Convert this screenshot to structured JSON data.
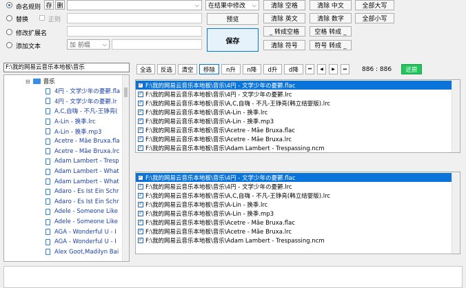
{
  "options": {
    "naming_rule": "命名规则",
    "save_short": "存",
    "delete_short": "删",
    "replace": "替换",
    "regex": "正则",
    "modify_ext": "修改扩展名",
    "add_text": "添加文本",
    "add_position": "加 前缀",
    "replace_scope": "在结果中修改"
  },
  "actions": {
    "preview": "预览",
    "save": "保存",
    "clear_space": "清除 空格",
    "clear_english": "清除 英文",
    "to_space": "_ 转成空格",
    "clear_symbol": "清除 符号",
    "clear_chinese": "清除 中文",
    "clear_digits": "清除 数字",
    "space_to_underscore": "空格 转成 _",
    "symbol_to_underscore": "符号 转成 _",
    "all_upper": "全部大写",
    "all_lower": "全部小写"
  },
  "path": "F:\\我的网易云音乐本地板\\音乐",
  "tree": {
    "folder": "音乐",
    "items": [
      "4円 - 文学少年の憂鬱.fla",
      "4円 - 文学少年の憂鬱.lr",
      "A,C,自嗨 - 不凡-王铮亮(",
      "A-Lin - 换季.lrc",
      "A-Lin - 换季.mp3",
      "Acetre - Mãe Bruxa.fla",
      "Acetre - Mãe Bruxa.lrc",
      "Adam Lambert - Tresp",
      "Adam Lambert - What",
      "Adam Lambert - What",
      "Adaro - Es Ist Ein Schr",
      "Adaro - Es Ist Ein Schr",
      "Adele - Someone Like",
      "Adele - Someone Like",
      "AGA - Wonderful U - I",
      "AGA - Wonderful U - I",
      "Alex Goot,Madilyn Bai"
    ]
  },
  "toolbar": {
    "select_all": "全选",
    "invert": "反选",
    "clear": "清空",
    "remove": "移除",
    "n_up": "n升",
    "n_down": "n降",
    "d_up": "d升",
    "d_down": "d降",
    "count": "886 : 886",
    "restore": "还原"
  },
  "files_top": [
    "F:\\我的网易云音乐本地板\\音乐\\4円 - 文学少年の憂鬱.flac",
    "F:\\我的网易云音乐本地板\\音乐\\4円 - 文学少年の憂鬱.lrc",
    "F:\\我的网易云音乐本地板\\音乐\\A,C,自嗨 - 不凡-王铮亮(韩立结婴版).lrc",
    "F:\\我的网易云音乐本地板\\音乐\\A-Lin - 换季.lrc",
    "F:\\我的网易云音乐本地板\\音乐\\A-Lin - 换季.mp3",
    "F:\\我的网易云音乐本地板\\音乐\\Acetre - Mãe Bruxa.flac",
    "F:\\我的网易云音乐本地板\\音乐\\Acetre - Mãe Bruxa.lrc",
    "F:\\我的网易云音乐本地板\\音乐\\Adam Lambert - Trespassing.ncm"
  ],
  "files_bottom": [
    "F:\\我的网易云音乐本地板\\音乐\\4円 - 文学少年の憂鬱.flac",
    "F:\\我的网易云音乐本地板\\音乐\\4円 - 文学少年の憂鬱.lrc",
    "F:\\我的网易云音乐本地板\\音乐\\A,C,自嗨 - 不凡-王铮亮(韩立结婴版).lrc",
    "F:\\我的网易云音乐本地板\\音乐\\A-Lin - 换季.lrc",
    "F:\\我的网易云音乐本地板\\音乐\\A-Lin - 换季.mp3",
    "F:\\我的网易云音乐本地板\\音乐\\Acetre - Mãe Bruxa.flac",
    "F:\\我的网易云音乐本地板\\音乐\\Acetre - Mãe Bruxa.lrc",
    "F:\\我的网易云音乐本地板\\音乐\\Adam Lambert - Trespassing.ncm"
  ]
}
